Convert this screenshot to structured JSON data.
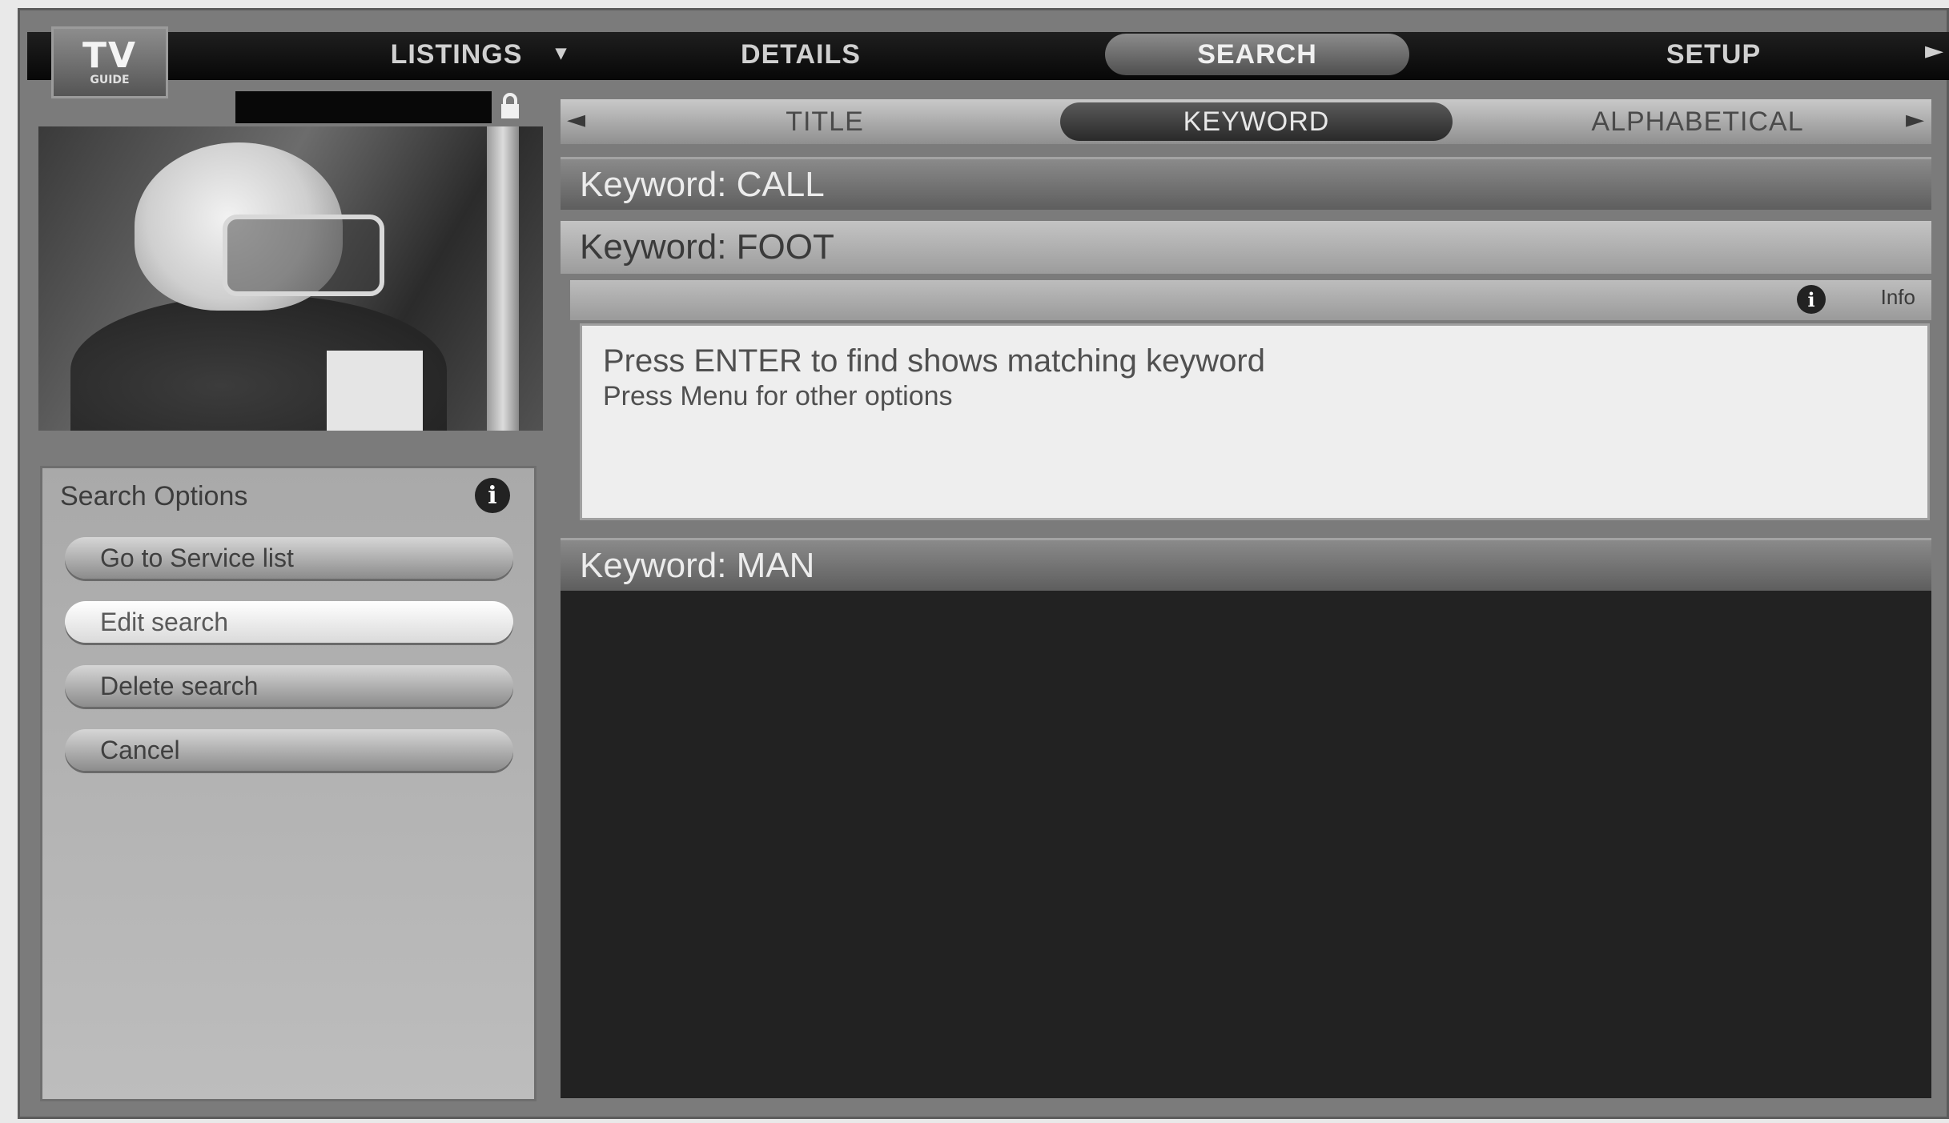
{
  "logo": {
    "main": "TV",
    "sub": "GUIDE"
  },
  "menu": [
    {
      "label": "LISTINGS"
    },
    {
      "label": "DETAILS"
    },
    {
      "label": "SEARCH"
    },
    {
      "label": "SETUP"
    }
  ],
  "tabs": [
    {
      "label": "TITLE"
    },
    {
      "label": "KEYWORD"
    },
    {
      "label": "ALPHABETICAL"
    }
  ],
  "keywords": [
    {
      "label": "Keyword: CALL"
    },
    {
      "label": "Keyword: FOOT"
    },
    {
      "label": "Keyword: MAN"
    }
  ],
  "info": {
    "label": "Info"
  },
  "message": {
    "line1": "Press ENTER to find shows matching keyword",
    "line2": "Press Menu for other options"
  },
  "search_options": {
    "title": "Search Options",
    "buttons": [
      {
        "label": "Go to Service list"
      },
      {
        "label": "Edit search"
      },
      {
        "label": "Delete search"
      },
      {
        "label": "Cancel"
      }
    ]
  },
  "icons": {
    "info": "i",
    "lock": "lock-icon",
    "arrow_left": "◄",
    "arrow_right": "►"
  }
}
